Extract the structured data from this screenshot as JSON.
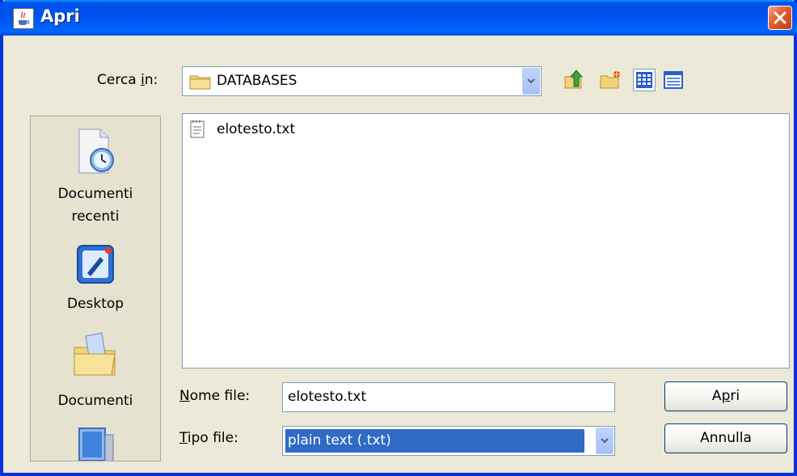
{
  "window": {
    "title": "Apri"
  },
  "lookin": {
    "label_before": "Cerca ",
    "label_mnemonic": "i",
    "label_after": "n:",
    "value": "DATABASES"
  },
  "toolbar": {
    "up_icon": "up-folder-icon",
    "new_folder_icon": "new-folder-icon",
    "list_view_icon": "list-view-icon",
    "details_view_icon": "details-view-icon"
  },
  "places": [
    {
      "label_line1": "Documenti",
      "label_line2": "recenti",
      "icon": "recent-documents-icon"
    },
    {
      "label_line1": "Desktop",
      "label_line2": "",
      "icon": "desktop-icon"
    },
    {
      "label_line1": "Documenti",
      "label_line2": "",
      "icon": "my-documents-icon"
    },
    {
      "label_line1": "",
      "label_line2": "",
      "icon": "my-computer-icon"
    }
  ],
  "files": [
    {
      "name": "elotesto.txt",
      "icon": "text-file-icon"
    }
  ],
  "filename": {
    "label_mnemonic": "N",
    "label_after": "ome file:",
    "value": "elotesto.txt"
  },
  "filetype": {
    "label_mnemonic": "T",
    "label_after": "ipo file:",
    "value": "plain text (.txt)"
  },
  "buttons": {
    "open_before": "A",
    "open_mnemonic": "p",
    "open_after": "ri",
    "cancel": "Annulla"
  },
  "colors": {
    "titlebar": "#0054E3",
    "selection": "#316AC5",
    "dialog_bg": "#ECE9D8"
  }
}
